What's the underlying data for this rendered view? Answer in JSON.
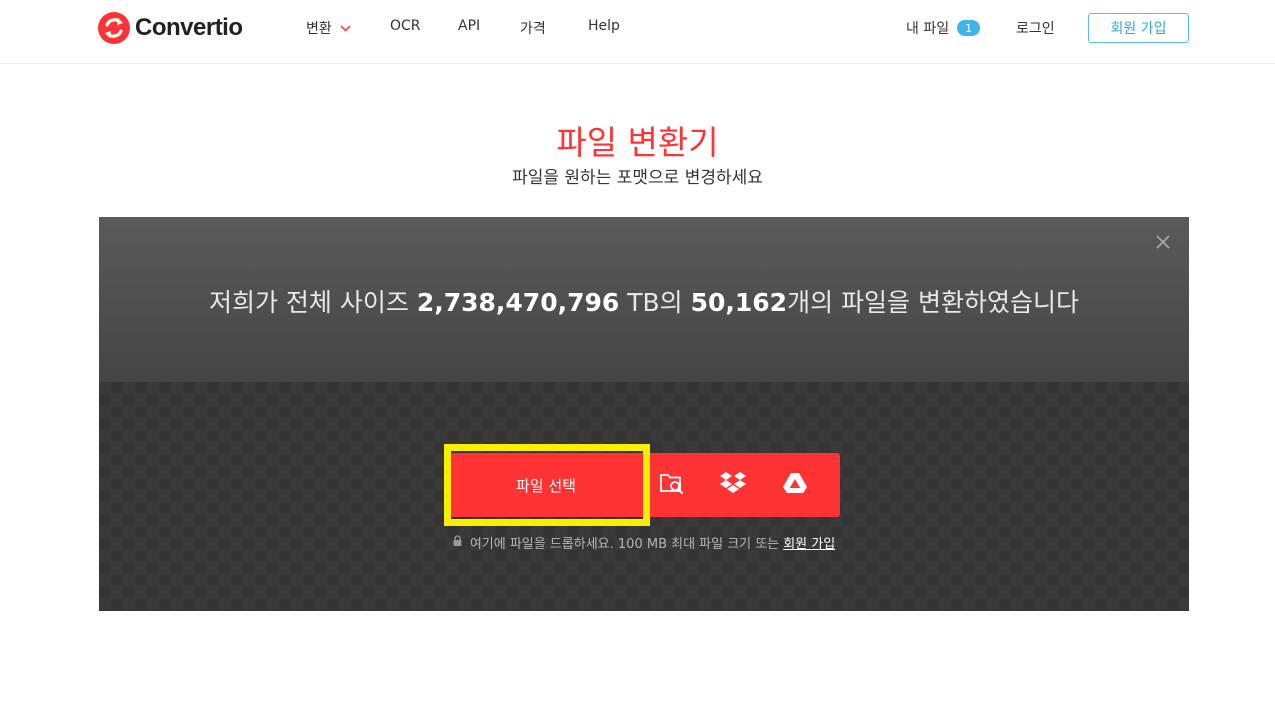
{
  "header": {
    "logo_text": "Convertio",
    "nav": [
      {
        "label": "변환",
        "has_dropdown": true
      },
      {
        "label": "OCR"
      },
      {
        "label": "API"
      },
      {
        "label": "가격"
      },
      {
        "label": "Help"
      }
    ],
    "my_files_label": "내 파일",
    "my_files_count": "1",
    "login_label": "로그인",
    "signup_label": "회원 가입"
  },
  "main": {
    "title": "파일 변환기",
    "subtitle": "파일을 원하는 포맷으로 변경하세요"
  },
  "converter": {
    "stats_prefix": "저희가 전체 사이즈 ",
    "stats_size": "2,738,470,796",
    "stats_mid": " TB의 ",
    "stats_count": "50,162",
    "stats_suffix": "개의 파일을 변환하였습니다",
    "choose_files_label": "파일 선택",
    "drop_note": "여기에 파일을 드롭하세요. 100 MB 최대 파일 크기 또는",
    "drop_note_link": "회원 가입"
  },
  "colors": {
    "brand": "#ff3333",
    "badge": "#3fb4e8",
    "highlight": "#f7ee00"
  }
}
